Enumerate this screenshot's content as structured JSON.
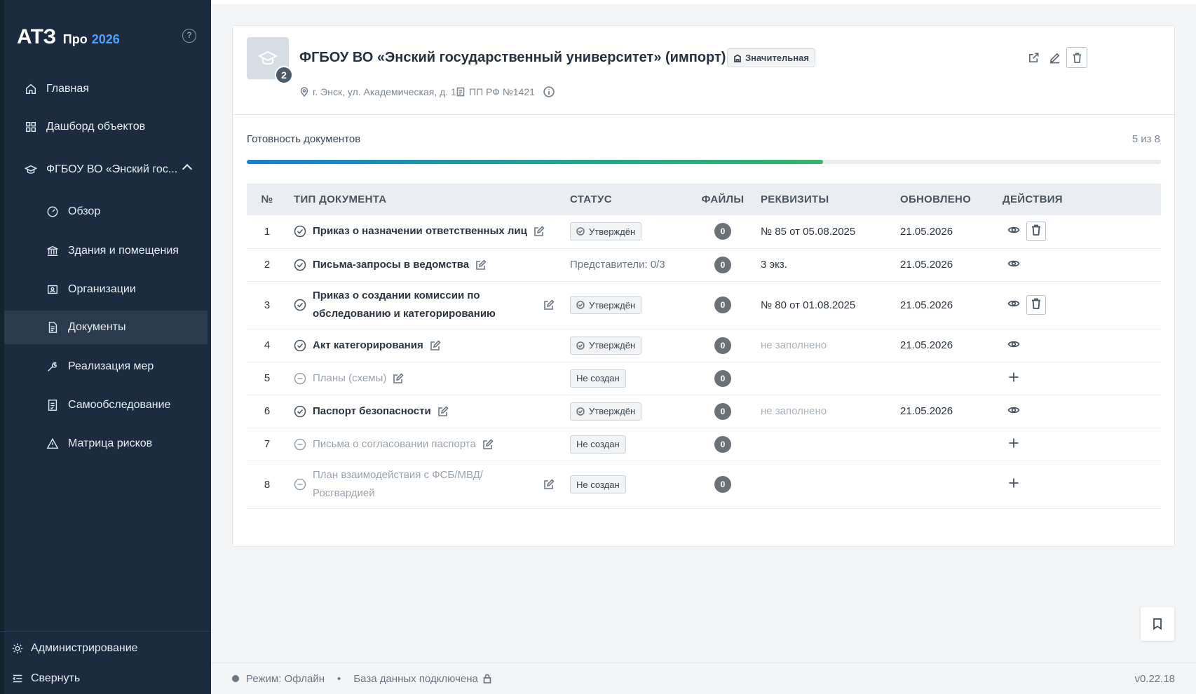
{
  "brand": {
    "logo": "АТЗ",
    "pro": "Про",
    "year": "2026"
  },
  "sidebar": {
    "items": [
      {
        "label": "Главная",
        "icon": "home-icon"
      },
      {
        "label": "Дашборд объектов",
        "icon": "grid-icon"
      },
      {
        "label": "ФГБОУ ВО «Энский гос...",
        "icon": "graduation-cap-icon",
        "expanded": true
      }
    ],
    "subitems": [
      {
        "label": "Обзор",
        "icon": "gauge-icon"
      },
      {
        "label": "Здания и помещения",
        "icon": "bank-icon"
      },
      {
        "label": "Организации",
        "icon": "id-card-icon"
      },
      {
        "label": "Документы",
        "icon": "document-icon",
        "active": true
      },
      {
        "label": "Реализация мер",
        "icon": "wrench-icon"
      },
      {
        "label": "Самообследование",
        "icon": "checklist-icon"
      },
      {
        "label": "Матрица рисков",
        "icon": "warning-icon"
      }
    ],
    "admin": "Администрирование",
    "collapse": "Свернуть"
  },
  "object": {
    "title": "ФГБОУ ВО «Энский государственный университет» (импорт)",
    "badge_count": "2",
    "category": "Значительная",
    "address": "г. Энск, ул. Академическая, д. 1",
    "regulation": "ПП РФ №1421"
  },
  "progress": {
    "label": "Готовность документов",
    "count": "5 из 8",
    "done": 5,
    "total": 8
  },
  "table": {
    "headers": [
      "№",
      "ТИП ДОКУМЕНТА",
      "СТАТУС",
      "ФАЙЛЫ",
      "РЕКВИЗИТЫ",
      "ОБНОВЛЕНО",
      "ДЕЙСТВИЯ"
    ],
    "rows": [
      {
        "n": "1",
        "name": "Приказ о назначении ответственных лиц",
        "created": true,
        "status": "Утверждён",
        "status_kind": "badge",
        "files": "0",
        "req": "№ 85 от 05.08.2025",
        "updated": "21.05.2026",
        "actions": [
          "view",
          "delete"
        ]
      },
      {
        "n": "2",
        "name": "Письма-запросы в ведомства",
        "created": true,
        "status": "Представители: 0/3",
        "status_kind": "text",
        "files": "0",
        "req": "3 экз.",
        "updated": "21.05.2026",
        "actions": [
          "view"
        ]
      },
      {
        "n": "3",
        "name": "Приказ о создании комиссии по обследованию и категорированию",
        "created": true,
        "status": "Утверждён",
        "status_kind": "badge",
        "files": "0",
        "req": "№ 80 от 01.08.2025",
        "updated": "21.05.2026",
        "actions": [
          "view",
          "delete"
        ]
      },
      {
        "n": "4",
        "name": "Акт категорирования",
        "created": true,
        "status": "Утверждён",
        "status_kind": "badge",
        "files": "0",
        "req": "не заполнено",
        "req_empty": true,
        "updated": "21.05.2026",
        "actions": [
          "view"
        ]
      },
      {
        "n": "5",
        "name": "Планы (схемы)",
        "created": false,
        "status": "Не создан",
        "status_kind": "badge",
        "files": "0",
        "req": "",
        "updated": "",
        "actions": [
          "add"
        ]
      },
      {
        "n": "6",
        "name": "Паспорт безопасности",
        "created": true,
        "status": "Утверждён",
        "status_kind": "badge",
        "files": "0",
        "req": "не заполнено",
        "req_empty": true,
        "updated": "21.05.2026",
        "actions": [
          "view"
        ]
      },
      {
        "n": "7",
        "name": "Письма о согласовании паспорта",
        "created": false,
        "status": "Не создан",
        "status_kind": "badge",
        "files": "0",
        "req": "",
        "updated": "",
        "actions": [
          "add"
        ]
      },
      {
        "n": "8",
        "name": "План взаимодействия с ФСБ/МВД/Росгвардией",
        "created": false,
        "status": "Не создан",
        "status_kind": "badge",
        "files": "0",
        "req": "",
        "updated": "",
        "actions": [
          "add"
        ]
      }
    ]
  },
  "footer": {
    "mode": "Режим: Офлайн",
    "separator": "•",
    "db": "База данных подключена",
    "version": "v0.22.18"
  }
}
